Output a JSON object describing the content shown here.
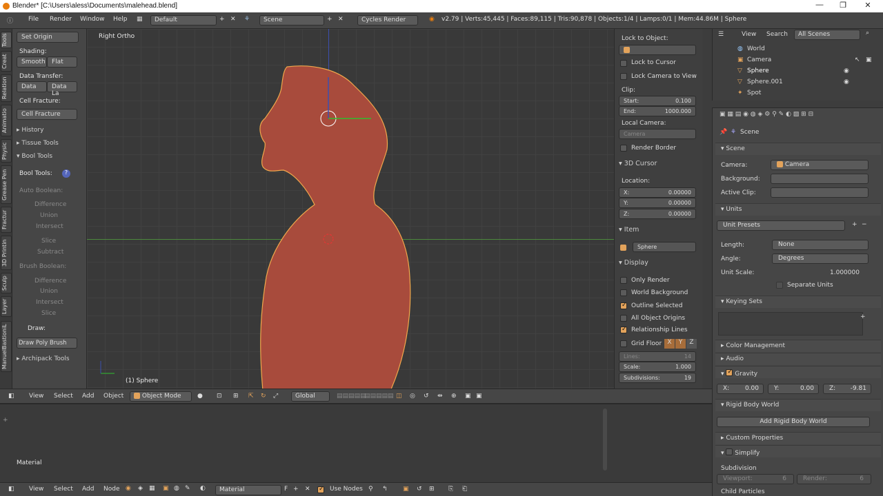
{
  "title": {
    "text": "Blender* [C:\\Users\\aless\\Documents\\malehead.blend]",
    "min": "—",
    "max": "❐",
    "close": "✕"
  },
  "topbar": {
    "menus": [
      "File",
      "Render",
      "Window",
      "Help"
    ],
    "layout": "Default",
    "scene": "Scene",
    "engine": "Cycles Render",
    "stats": "v2.79 | Verts:45,445 | Faces:89,115 | Tris:90,878 | Objects:1/4 | Lamps:0/1 | Mem:44.86M | Sphere"
  },
  "tabs": [
    "Tools",
    "Creat",
    "Relation",
    "Animatio",
    "Physic",
    "Grease Pen",
    "Fractur",
    "3D Printin",
    "Sculp",
    "Layer",
    "ManuelBastioniL"
  ],
  "toolshelf": {
    "set_origin": "Set Origin",
    "shading": "Shading:",
    "smooth": "Smooth",
    "flat": "Flat",
    "data_transfer": "Data Transfer:",
    "data": "Data",
    "data_la": "Data La",
    "cell_fracture_h": "Cell Fracture:",
    "cell_fracture": "Cell Fracture",
    "history": "History",
    "tissue_tools": "Tissue Tools",
    "bool_tools": "Bool Tools",
    "bool_tools_label": "Bool Tools:",
    "auto_boolean": "Auto Boolean:",
    "difference": "Difference",
    "union": "Union",
    "intersect": "Intersect",
    "slice": "Slice",
    "subtract": "Subtract",
    "brush_boolean": "Brush Boolean:",
    "draw": "Draw:",
    "draw_poly": "Draw Poly Brush",
    "archipack": "Archipack Tools"
  },
  "viewport": {
    "view_name": "Right Ortho",
    "object_label": "(1) Sphere"
  },
  "npanel": {
    "lock_to_object": "Lock to Object:",
    "lock_to_cursor": "Lock to Cursor",
    "lock_camera": "Lock Camera to View",
    "clip": "Clip:",
    "start_label": "Start:",
    "start_val": "0.100",
    "end_label": "End:",
    "end_val": "1000.000",
    "local_camera": "Local Camera:",
    "camera": "Camera",
    "render_border": "Render Border",
    "cursor_h": "3D Cursor",
    "location": "Location:",
    "x_label": "X:",
    "x_val": "0.00000",
    "y_label": "Y:",
    "y_val": "0.00000",
    "z_label": "Z:",
    "z_val": "0.00000",
    "item_h": "Item",
    "item_name": "Sphere",
    "display_h": "Display",
    "only_render": "Only Render",
    "world_bg": "World Background",
    "outline_sel": "Outline Selected",
    "all_origins": "All Object Origins",
    "rel_lines": "Relationship Lines",
    "grid_floor": "Grid Floor",
    "gx": "X",
    "gy": "Y",
    "gz": "Z",
    "lines_label": "Lines:",
    "lines_val": "14",
    "scale_label": "Scale:",
    "scale_val": "1.000",
    "subdiv_label": "Subdivisions:",
    "subdiv_val": "19"
  },
  "vheader": {
    "view": "View",
    "select": "Select",
    "add": "Add",
    "object": "Object",
    "mode": "Object Mode",
    "orient": "Global"
  },
  "nodeed": {
    "label": "Material"
  },
  "ndheader": {
    "view": "View",
    "select": "Select",
    "add": "Add",
    "node": "Node",
    "material": "Material",
    "f": "F",
    "use_nodes": "Use Nodes"
  },
  "outliner": {
    "view": "View",
    "search": "Search",
    "scenes": "All Scenes",
    "items": [
      "World",
      "Camera",
      "Sphere",
      "Sphere.001",
      "Spot"
    ]
  },
  "props": {
    "breadcrumb": "Scene",
    "scene_h": "Scene",
    "camera_label": "Camera:",
    "camera_val": "Camera",
    "background_label": "Background:",
    "active_clip": "Active Clip:",
    "units_h": "Units",
    "unit_presets": "Unit Presets",
    "length_label": "Length:",
    "length_val": "None",
    "angle_label": "Angle:",
    "angle_val": "Degrees",
    "unit_scale": "Unit Scale:",
    "unit_scale_val": "1.000000",
    "sep_units": "Separate Units",
    "keying_h": "Keying Sets",
    "color_mgmt": "Color Management",
    "audio": "Audio",
    "gravity": "Gravity",
    "gx": "X:",
    "gxv": "0.00",
    "gy": "Y:",
    "gyv": "0.00",
    "gz": "Z:",
    "gzv": "-9.81",
    "rigid_h": "Rigid Body World",
    "add_rigid": "Add Rigid Body World",
    "custom_props": "Custom Properties",
    "simplify": "Simplify",
    "subdivision": "Subdivision",
    "viewport_label": "Viewport:",
    "viewport_val": "6",
    "render_label": "Render:",
    "render_val": "6",
    "child_particles": "Child Particles"
  },
  "colors": {
    "accent": "#e3a35b",
    "mesh": "#a84b3c",
    "selected_outline": "#f0a84c"
  }
}
